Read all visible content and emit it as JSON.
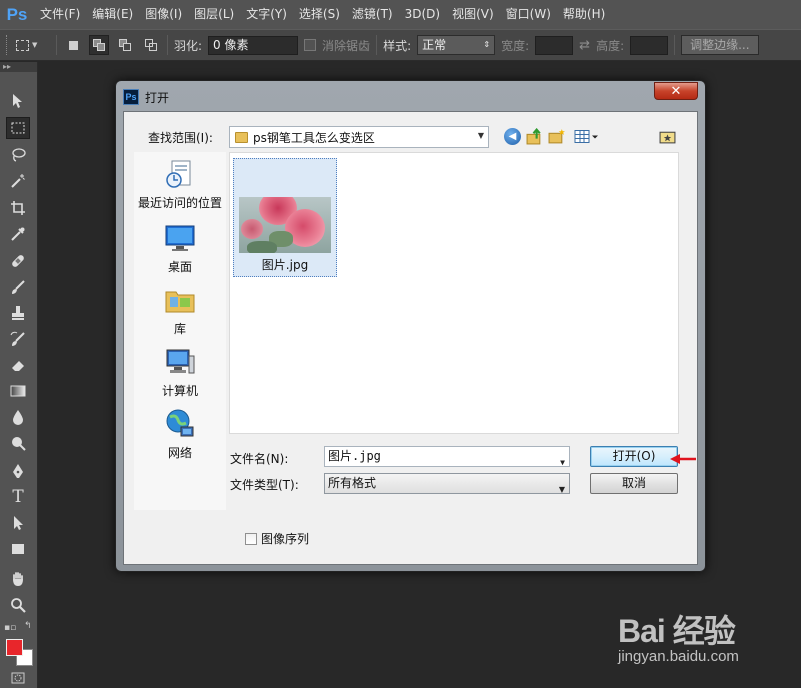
{
  "app": {
    "logo": "Ps",
    "menu": [
      "文件(F)",
      "编辑(E)",
      "图像(I)",
      "图层(L)",
      "文字(Y)",
      "选择(S)",
      "滤镜(T)",
      "3D(D)",
      "视图(V)",
      "窗口(W)",
      "帮助(H)"
    ]
  },
  "options": {
    "feather_label": "羽化:",
    "feather_value": "0 像素",
    "antialias_label": "消除锯齿",
    "style_label": "样式:",
    "style_value": "正常",
    "width_label": "宽度:",
    "height_label": "高度:",
    "refine_label": "调整边缘..."
  },
  "toolbox": {
    "header": "▸▸",
    "colors": {
      "foreground": "#e8262b",
      "background": "#ffffff"
    }
  },
  "dialog": {
    "title": "打开",
    "close_label": "✕",
    "lookin_label": "查找范围(I):",
    "lookin_value": "ps钢笔工具怎么变选区",
    "places": [
      "最近访问的位置",
      "桌面",
      "库",
      "计算机",
      "网络"
    ],
    "files": [
      {
        "name": "图片.jpg"
      }
    ],
    "filename_label": "文件名(N):",
    "filename_value": "图片.jpg",
    "filetype_label": "文件类型(T):",
    "filetype_value": "所有格式",
    "open_button": "打开(O)",
    "cancel_button": "取消",
    "sequence_label": "图像序列"
  },
  "watermark": {
    "logo": "Bai 经验",
    "sub": "jingyan.baidu.com"
  }
}
